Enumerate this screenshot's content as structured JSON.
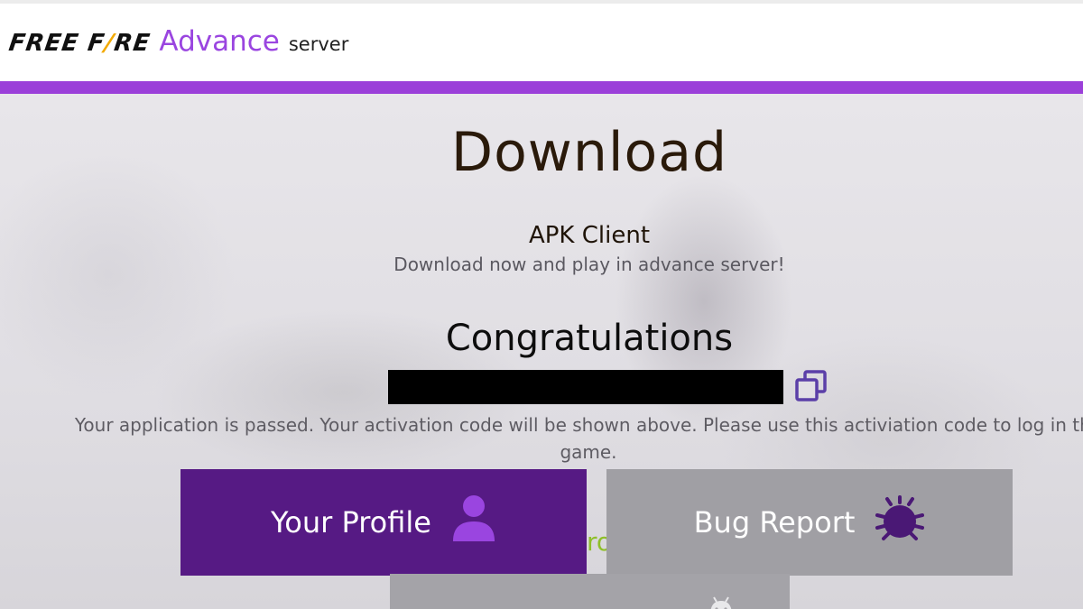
{
  "header": {
    "logo_brand_part1": "FREE F",
    "logo_brand_accent": "/",
    "logo_brand_part2": "RE",
    "logo_advance": "Advance",
    "logo_server": "server"
  },
  "main": {
    "title": "Download",
    "apk_title": "APK Client",
    "apk_subtitle": "Download now and play in advance server!",
    "congrats": "Congratulations",
    "notice": "Your application is passed. Your activation code will be shown above. Please use this activiation code to log in the game.",
    "green_peek": "ro"
  },
  "buttons": {
    "profile_label": "Your Profile",
    "bug_label": "Bug Report"
  },
  "colors": {
    "accent_purple": "#9b3fd9",
    "profile_button": "#561a84",
    "bug_button": "#a09fa4",
    "icon_purple": "#9a45e0",
    "bug_icon": "#4a1875"
  },
  "icons": {
    "copy": "copy-icon",
    "profile": "user-icon",
    "bug": "bug-icon",
    "android": "android-icon"
  }
}
